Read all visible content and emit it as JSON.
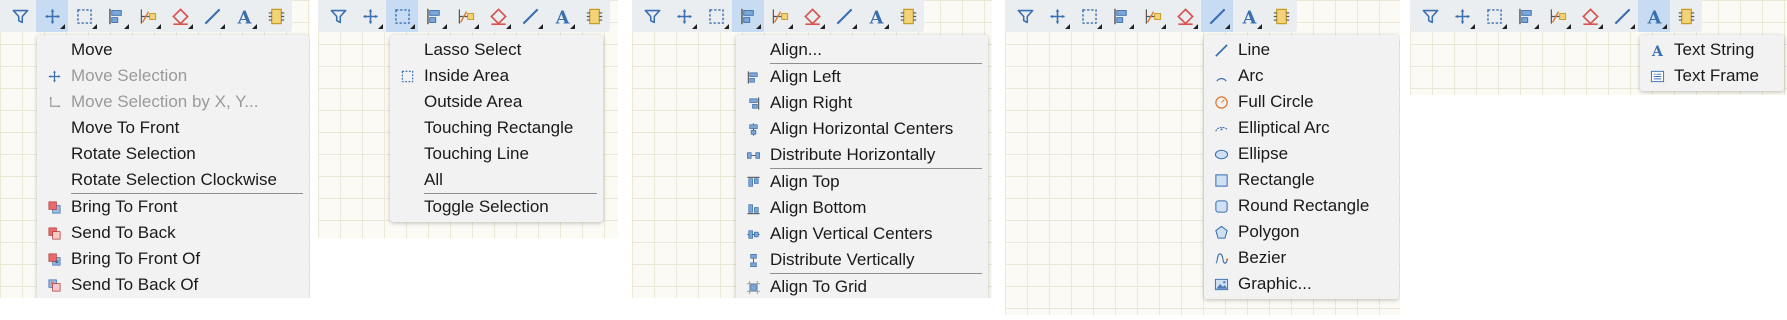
{
  "panels": [
    {
      "id": "edit",
      "active_tool": "move-tool",
      "menu_items": [
        {
          "label": "Move",
          "icon": null,
          "enabled": true
        },
        {
          "label": "Move Selection",
          "icon": "move-cross-icon",
          "enabled": false
        },
        {
          "label": "Move Selection by X, Y...",
          "icon": "move-xy-icon",
          "enabled": false
        },
        {
          "label": "Move To Front",
          "icon": null,
          "enabled": true
        },
        {
          "label": "Rotate Selection",
          "icon": null,
          "enabled": true
        },
        {
          "label": "Rotate Selection Clockwise",
          "icon": null,
          "enabled": true,
          "separator_after": true
        },
        {
          "label": "Bring To Front",
          "icon": "bring-to-front-icon",
          "enabled": true
        },
        {
          "label": "Send To Back",
          "icon": "send-to-back-icon",
          "enabled": true
        },
        {
          "label": "Bring To Front Of",
          "icon": "bring-to-front-of-icon",
          "enabled": true
        },
        {
          "label": "Send To Back Of",
          "icon": "send-to-back-of-icon",
          "enabled": true
        }
      ]
    },
    {
      "id": "select",
      "active_tool": "select-area-tool",
      "menu_items": [
        {
          "label": "Lasso Select",
          "icon": null,
          "enabled": true
        },
        {
          "label": "Inside Area",
          "icon": "dashed-rect-icon",
          "enabled": true
        },
        {
          "label": "Outside Area",
          "icon": null,
          "enabled": true
        },
        {
          "label": "Touching Rectangle",
          "icon": null,
          "enabled": true
        },
        {
          "label": "Touching Line",
          "icon": null,
          "enabled": true
        },
        {
          "label": "All",
          "icon": null,
          "enabled": true,
          "separator_after": true
        },
        {
          "label": "Toggle Selection",
          "icon": null,
          "enabled": true
        }
      ]
    },
    {
      "id": "align",
      "active_tool": "align-tool",
      "menu_items": [
        {
          "label": "Align...",
          "icon": null,
          "enabled": true,
          "separator_after": true
        },
        {
          "label": "Align Left",
          "icon": "align-left-icon",
          "enabled": true
        },
        {
          "label": "Align Right",
          "icon": "align-right-icon",
          "enabled": true
        },
        {
          "label": "Align Horizontal Centers",
          "icon": "align-hcenter-icon",
          "enabled": true
        },
        {
          "label": "Distribute Horizontally",
          "icon": "distribute-h-icon",
          "enabled": true,
          "separator_after": true
        },
        {
          "label": "Align Top",
          "icon": "align-top-icon",
          "enabled": true
        },
        {
          "label": "Align Bottom",
          "icon": "align-bottom-icon",
          "enabled": true
        },
        {
          "label": "Align Vertical Centers",
          "icon": "align-vcenter-icon",
          "enabled": true
        },
        {
          "label": "Distribute Vertically",
          "icon": "distribute-v-icon",
          "enabled": true,
          "separator_after": true
        },
        {
          "label": "Align To Grid",
          "icon": "align-grid-icon",
          "enabled": true
        }
      ]
    },
    {
      "id": "draw",
      "active_tool": "line-tool",
      "menu_items": [
        {
          "label": "Line",
          "icon": "line-icon",
          "enabled": true
        },
        {
          "label": "Arc",
          "icon": "arc-icon",
          "enabled": true
        },
        {
          "label": "Full Circle",
          "icon": "full-circle-icon",
          "enabled": true
        },
        {
          "label": "Elliptical Arc",
          "icon": "elliptical-arc-icon",
          "enabled": true
        },
        {
          "label": "Ellipse",
          "icon": "ellipse-icon",
          "enabled": true
        },
        {
          "label": "Rectangle",
          "icon": "rectangle-icon",
          "enabled": true
        },
        {
          "label": "Round Rectangle",
          "icon": "round-rectangle-icon",
          "enabled": true
        },
        {
          "label": "Polygon",
          "icon": "polygon-icon",
          "enabled": true
        },
        {
          "label": "Bezier",
          "icon": "bezier-icon",
          "enabled": true
        },
        {
          "label": "Graphic...",
          "icon": "graphic-icon",
          "enabled": true
        }
      ]
    },
    {
      "id": "text",
      "active_tool": "text-tool",
      "menu_items": [
        {
          "label": "Text String",
          "icon": "text-string-icon",
          "enabled": true
        },
        {
          "label": "Text Frame",
          "icon": "text-frame-icon",
          "enabled": true
        }
      ]
    }
  ],
  "toolbar_tools": [
    {
      "name": "filter-tool",
      "icon": "filter-icon",
      "has_submenu": false
    },
    {
      "name": "move-tool",
      "icon": "move-cross-icon",
      "has_submenu": true
    },
    {
      "name": "select-area-tool",
      "icon": "dashed-rect-icon",
      "has_submenu": true
    },
    {
      "name": "align-tool",
      "icon": "align-left-icon",
      "has_submenu": true
    },
    {
      "name": "node-tool",
      "icon": "node-edit-icon",
      "has_submenu": true
    },
    {
      "name": "eraser-tool",
      "icon": "eraser-icon",
      "has_submenu": true
    },
    {
      "name": "line-tool",
      "icon": "line-icon",
      "has_submenu": true
    },
    {
      "name": "text-tool",
      "icon": "text-a-icon",
      "has_submenu": true
    },
    {
      "name": "component-tool",
      "icon": "component-icon",
      "has_submenu": false
    }
  ],
  "colors": {
    "accent_blue": "#3a6fb0",
    "icon_red": "#d9534f",
    "icon_orange": "#e0762e",
    "active_tool_bg": "#c7dcf3",
    "menu_bg": "#f2f2f2",
    "canvas_bg": "#fbfaf4"
  }
}
